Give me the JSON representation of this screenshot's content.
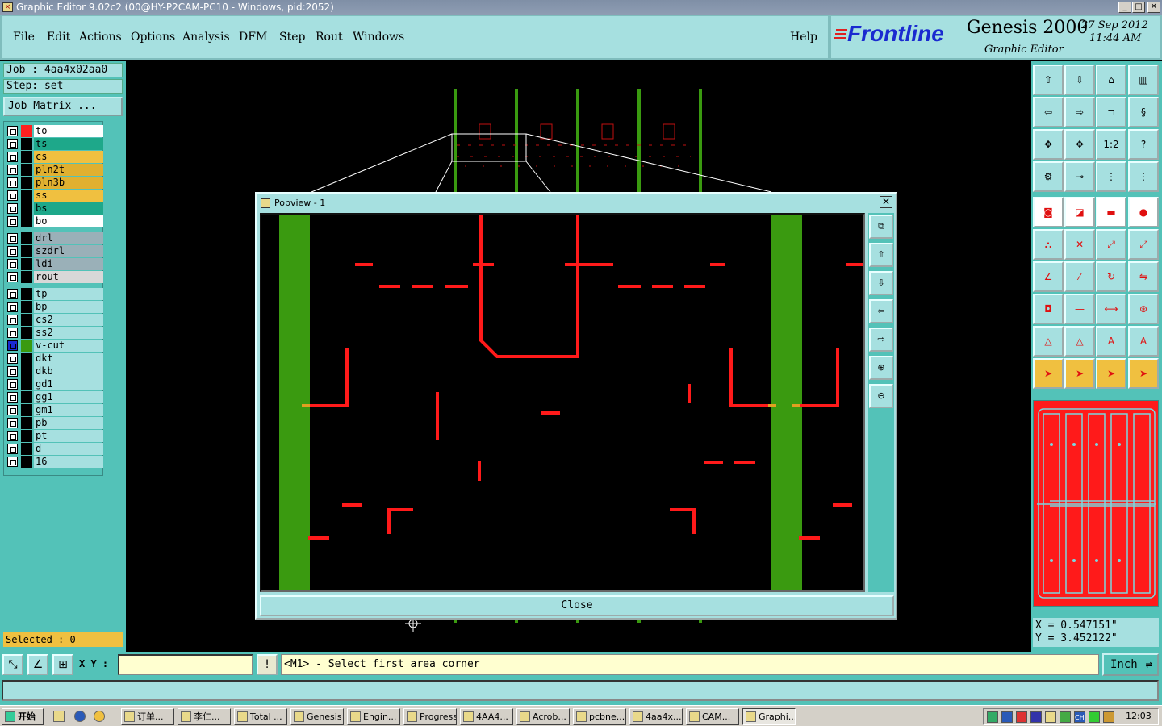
{
  "window": {
    "title": "Graphic Editor 9.02c2 (00@HY-P2CAM-PC10 - Windows, pid:2052)",
    "controls": [
      "_",
      "□",
      "✕"
    ]
  },
  "menu": {
    "items": [
      "File",
      "Edit",
      "Actions",
      "Options",
      "Analysis",
      "DFM",
      "Step",
      "Rout",
      "Windows"
    ],
    "help": "Help"
  },
  "brand": {
    "logo": "Frontline",
    "product": "Genesis 2000",
    "subtitle": "Graphic Editor",
    "date": "27  Sep  2012",
    "time": "11:44  AM"
  },
  "job": {
    "job_label": "Job : 4aa4x02aa0",
    "step_label": "Step: set",
    "matrix_button": "Job Matrix ..."
  },
  "layers": [
    {
      "name": "to",
      "color": "#ff2020",
      "bg": "#ffffff"
    },
    {
      "name": "ts",
      "color": "#000000",
      "bg": "#1ea88a"
    },
    {
      "name": "cs",
      "color": "#000000",
      "bg": "#f0c040"
    },
    {
      "name": "pln2t",
      "color": "#000000",
      "bg": "#e0b030"
    },
    {
      "name": "pln3b",
      "color": "#000000",
      "bg": "#e0b030"
    },
    {
      "name": "ss",
      "color": "#000000",
      "bg": "#f0c040"
    },
    {
      "name": "bs",
      "color": "#000000",
      "bg": "#1ea88a"
    },
    {
      "name": "bo",
      "color": "#000000",
      "bg": "#ffffff"
    },
    {
      "name": "drl",
      "color": "#000000",
      "bg": "#9ab0b8"
    },
    {
      "name": "szdrl",
      "color": "#000000",
      "bg": "#9ab0b8"
    },
    {
      "name": "ldi",
      "color": "#000000",
      "bg": "#9ab0b8"
    },
    {
      "name": "rout",
      "color": "#000000",
      "bg": "#d8d8d8"
    },
    {
      "name": "tp",
      "color": "#000000",
      "bg": "#a6e0e0"
    },
    {
      "name": "bp",
      "color": "#000000",
      "bg": "#a6e0e0"
    },
    {
      "name": "cs2",
      "color": "#000000",
      "bg": "#a6e0e0"
    },
    {
      "name": "ss2",
      "color": "#000000",
      "bg": "#a6e0e0"
    },
    {
      "name": "v-cut",
      "color": "#3a9a10",
      "bg": "#a6e0e0"
    },
    {
      "name": "dkt",
      "color": "#000000",
      "bg": "#a6e0e0"
    },
    {
      "name": "dkb",
      "color": "#000000",
      "bg": "#a6e0e0"
    },
    {
      "name": "gd1",
      "color": "#000000",
      "bg": "#a6e0e0"
    },
    {
      "name": "gg1",
      "color": "#000000",
      "bg": "#a6e0e0"
    },
    {
      "name": "gm1",
      "color": "#000000",
      "bg": "#a6e0e0"
    },
    {
      "name": "pb",
      "color": "#000000",
      "bg": "#a6e0e0"
    },
    {
      "name": "pt",
      "color": "#000000",
      "bg": "#a6e0e0"
    },
    {
      "name": "d",
      "color": "#000000",
      "bg": "#a6e0e0"
    },
    {
      "name": "16",
      "color": "#000000",
      "bg": "#a6e0e0"
    }
  ],
  "selected": "Selected : 0",
  "popview": {
    "title": "Popview - 1",
    "close_x": "✕",
    "close_button": "Close"
  },
  "coords": {
    "x": "X = 0.547151\"",
    "y": "Y = 3.452122\""
  },
  "cmd": {
    "xy_label": "X Y :",
    "prompt": "<M1> - Select first area corner",
    "unit": "Inch",
    "exclaim": "!"
  },
  "taskbar": {
    "start": "开始",
    "items": [
      "订单...",
      "李仁...",
      "Total ...",
      "Genesis",
      "Engin...",
      "Progress",
      "4AA4...",
      "Acrob...",
      "pcbne...",
      "4aa4x...",
      "CAM...",
      "Graphi..."
    ],
    "active_index": 11,
    "clock": "12:03"
  },
  "colors": {
    "panel": "#53c2b8",
    "panel_light": "#a6e0e0",
    "trace": "#ff1a1a",
    "vcut": "#3a9a10"
  }
}
